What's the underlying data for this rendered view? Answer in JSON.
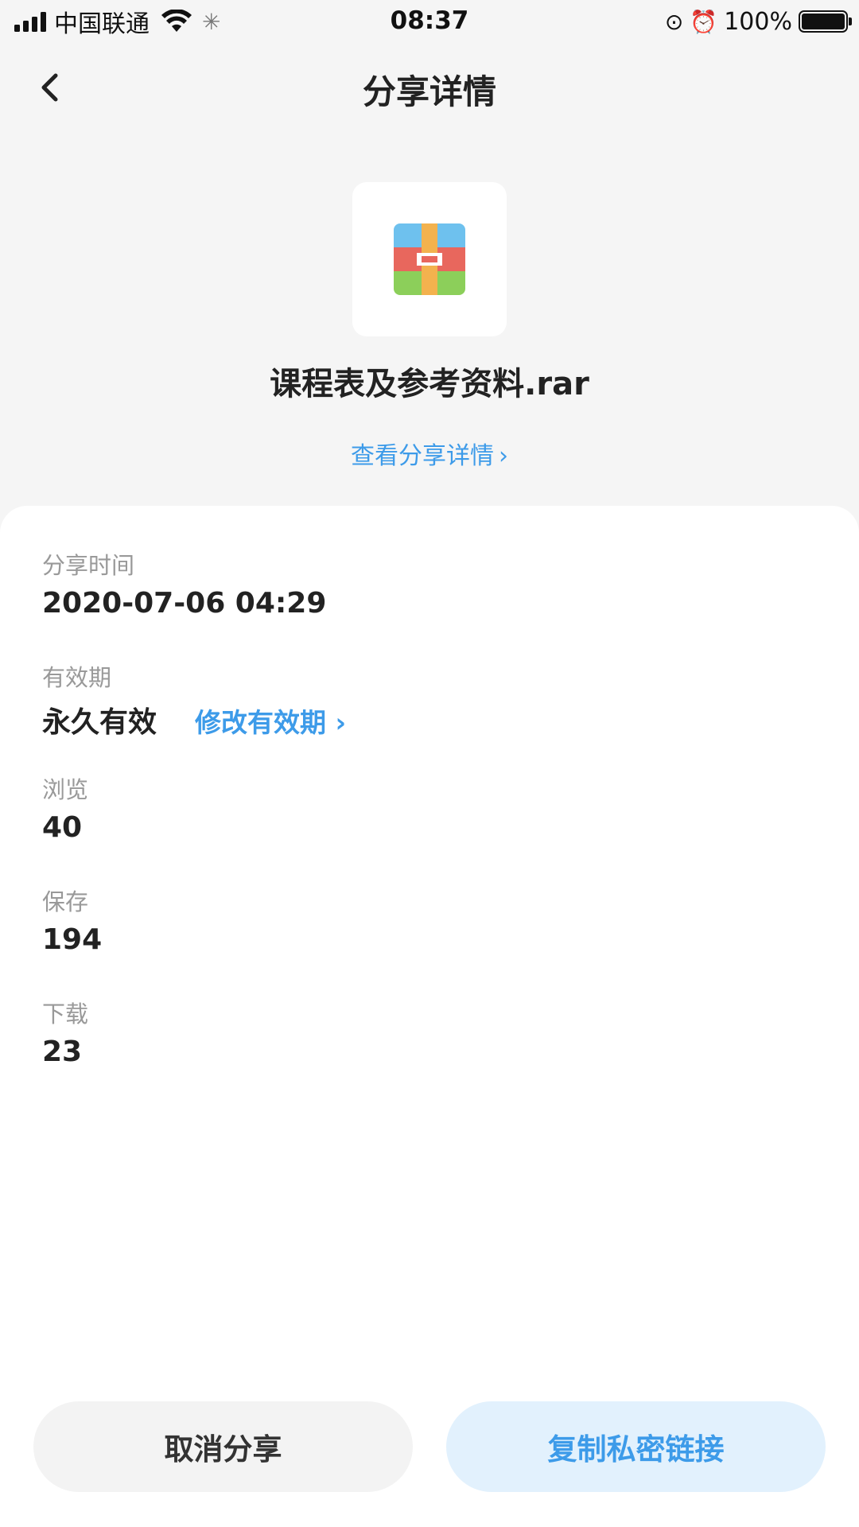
{
  "status_bar": {
    "carrier": "中国联通",
    "time": "08:37",
    "battery": "100%"
  },
  "nav": {
    "title": "分享详情"
  },
  "file": {
    "icon": "archive-rar-icon",
    "name": "课程表及参考资料.rar",
    "view_detail_label": "查看分享详情"
  },
  "details": {
    "share_time": {
      "label": "分享时间",
      "value": "2020-07-06 04:29"
    },
    "validity": {
      "label": "有效期",
      "value": "永久有效",
      "modify_label": "修改有效期"
    },
    "views": {
      "label": "浏览",
      "value": "40"
    },
    "saves": {
      "label": "保存",
      "value": "194"
    },
    "downloads": {
      "label": "下载",
      "value": "23"
    }
  },
  "actions": {
    "cancel_label": "取消分享",
    "copy_label": "复制私密链接"
  },
  "colors": {
    "accent": "#3d9be9",
    "copy_button_bg": "#e2f1fd",
    "page_bg": "#f5f5f5"
  }
}
